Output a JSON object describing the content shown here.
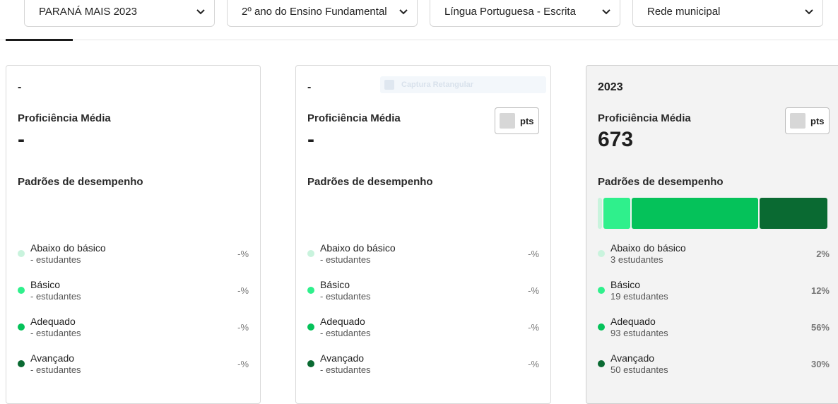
{
  "filters": {
    "edition": "PARANÁ MAIS 2023",
    "grade": "2º ano do Ensino Fundamental",
    "subject": "Língua Portuguesa - Escrita",
    "network": "Rede municipal"
  },
  "ghost_chip": {
    "text": "Captura Retangular"
  },
  "cards": [
    {
      "year": "-",
      "prof_title": "Proficiência Média",
      "prof_value": "-",
      "show_pts": false,
      "padroes_title": "Padrões de desempenho",
      "levels": [
        {
          "name": "Abaixo do básico",
          "count": "- estudantes",
          "pct": "-%"
        },
        {
          "name": "Básico",
          "count": "- estudantes",
          "pct": "-%"
        },
        {
          "name": "Adequado",
          "count": "- estudantes",
          "pct": "-%"
        },
        {
          "name": "Avançado",
          "count": "- estudantes",
          "pct": "-%"
        }
      ]
    },
    {
      "year": "-",
      "prof_title": "Proficiência Média",
      "prof_value": "-",
      "show_pts": true,
      "pts_label": "pts",
      "padroes_title": "Padrões de desempenho",
      "levels": [
        {
          "name": "Abaixo do básico",
          "count": "- estudantes",
          "pct": "-%"
        },
        {
          "name": "Básico",
          "count": "- estudantes",
          "pct": "-%"
        },
        {
          "name": "Adequado",
          "count": "- estudantes",
          "pct": "-%"
        },
        {
          "name": "Avançado",
          "count": "- estudantes",
          "pct": "-%"
        }
      ]
    },
    {
      "year": "2023",
      "prof_title": "Proficiência Média",
      "prof_value": "673",
      "show_pts": true,
      "pts_label": "pts",
      "padroes_title": "Padrões de desempenho",
      "levels": [
        {
          "name": "Abaixo do básico",
          "count": "3 estudantes",
          "pct": "2%",
          "share": 2
        },
        {
          "name": "Básico",
          "count": "19 estudantes",
          "pct": "12%",
          "share": 12
        },
        {
          "name": "Adequado",
          "count": "93 estudantes",
          "pct": "56%",
          "share": 56
        },
        {
          "name": "Avançado",
          "count": "50 estudantes",
          "pct": "30%",
          "share": 30
        }
      ]
    }
  ],
  "colors": {
    "abaixo_do_basico": "#c9f3dd",
    "basico": "#2ff08c",
    "adequado": "#05c25a",
    "avancado": "#0a6a32"
  }
}
